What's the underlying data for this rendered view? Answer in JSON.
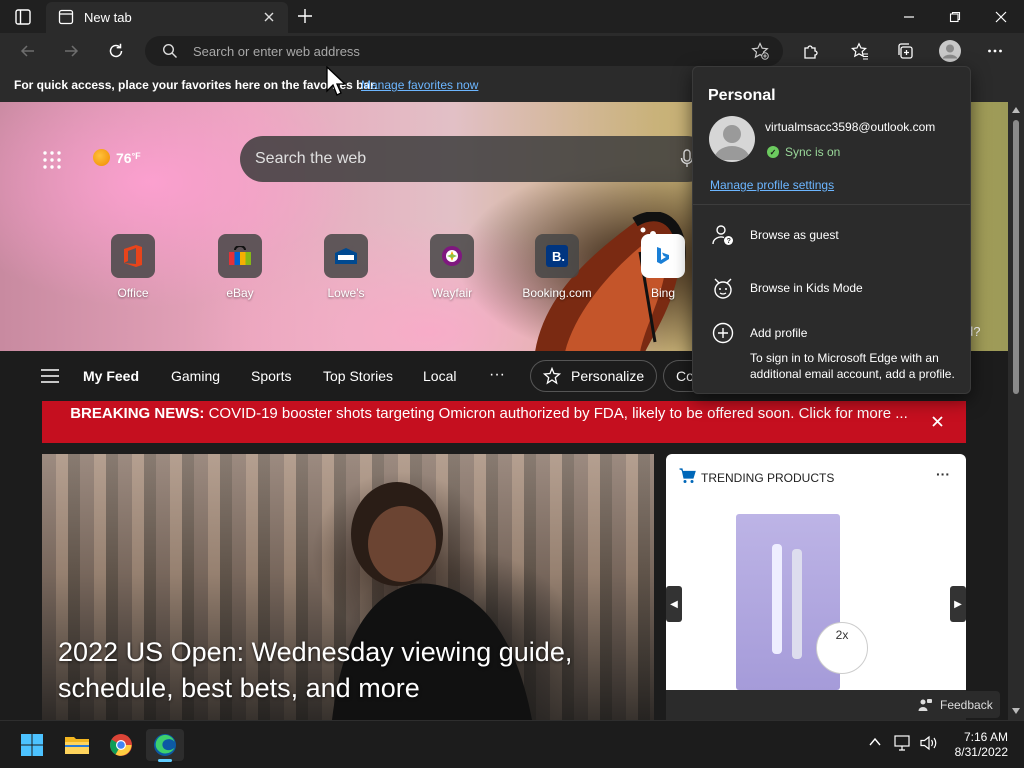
{
  "tab": {
    "title": "New tab"
  },
  "address": {
    "placeholder": "Search or enter web address"
  },
  "favorites_bar": {
    "message": "For quick access, place your favorites here on the favorites bar.",
    "link": "Manage favorites now"
  },
  "weather": {
    "temp": "76",
    "unit": "°F"
  },
  "search": {
    "placeholder": "Search the web"
  },
  "quick_links": [
    {
      "label": "Office"
    },
    {
      "label": "eBay"
    },
    {
      "label": "Lowe's"
    },
    {
      "label": "Wayfair"
    },
    {
      "label": "Booking.com"
    },
    {
      "label": "Bing"
    }
  ],
  "hero_fragment": "d?",
  "feed_nav": {
    "items": [
      "My Feed",
      "Gaming",
      "Sports",
      "Top Stories",
      "Local"
    ],
    "more": "···",
    "personalize": "Personalize",
    "partial": "Co"
  },
  "breaking": {
    "label": "BREAKING NEWS:",
    "text": "COVID-19 booster shots targeting Omicron authorized by FDA, likely to be offered soon. Click for more ..."
  },
  "article": {
    "headline": "2022 US Open: Wednesday viewing guide, schedule, best bets, and more"
  },
  "trending": {
    "title": "TRENDING PRODUCTS",
    "more": "···",
    "badge": "2x"
  },
  "feedback": {
    "label": "Feedback"
  },
  "profile": {
    "heading": "Personal",
    "email": "virtualmsacc3598@outlook.com",
    "sync": "Sync is on",
    "manage": "Manage profile settings",
    "guest": "Browse as guest",
    "kids": "Browse in Kids Mode",
    "add": "Add profile",
    "add_desc": "To sign in to Microsoft Edge with an additional email account, add a profile."
  },
  "clock": {
    "time": "7:16 AM",
    "date": "8/31/2022"
  },
  "colors": {
    "accent": "#6cb6ff",
    "breaking": "#c50f1f",
    "sync": "#6ccb5f"
  }
}
